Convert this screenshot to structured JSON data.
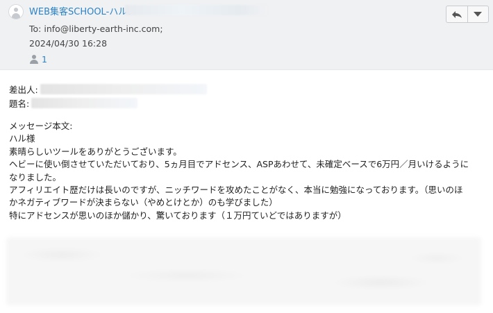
{
  "header": {
    "sender": "WEB集客SCHOOL-ハル：",
    "to_line": "To: info@liberty-earth-inc.com;",
    "datetime": "2024/04/30 16:28",
    "recipient_count": "1",
    "buttons": {
      "reply": "reply-icon",
      "more": "chevron-down-icon"
    }
  },
  "fields": {
    "sender_label": "差出人:",
    "subject_label": "題名:"
  },
  "body": {
    "lines": [
      "メッセージ本文:",
      "ハル様",
      "素晴らしいツールをありがとうございます。",
      "ヘビーに使い倒させていただいており、5ヵ月目でアドセンス、ASPあわせて、未確定ベースで6万円／月いけるように",
      "なりました。",
      "アフィリエイト歴だけは長いのですが、ニッチワードを攻めたことがなく、本当に勉強になっております。（思いのほ",
      "かネガティブワードが決まらない（やめとけとか）のも学びました）",
      "特にアドセンスが思いのほか儲かり、驚いております（１万円ていどではありますが）"
    ]
  },
  "colors": {
    "link": "#2c83c8",
    "header_bg": "#f0f1f3"
  }
}
